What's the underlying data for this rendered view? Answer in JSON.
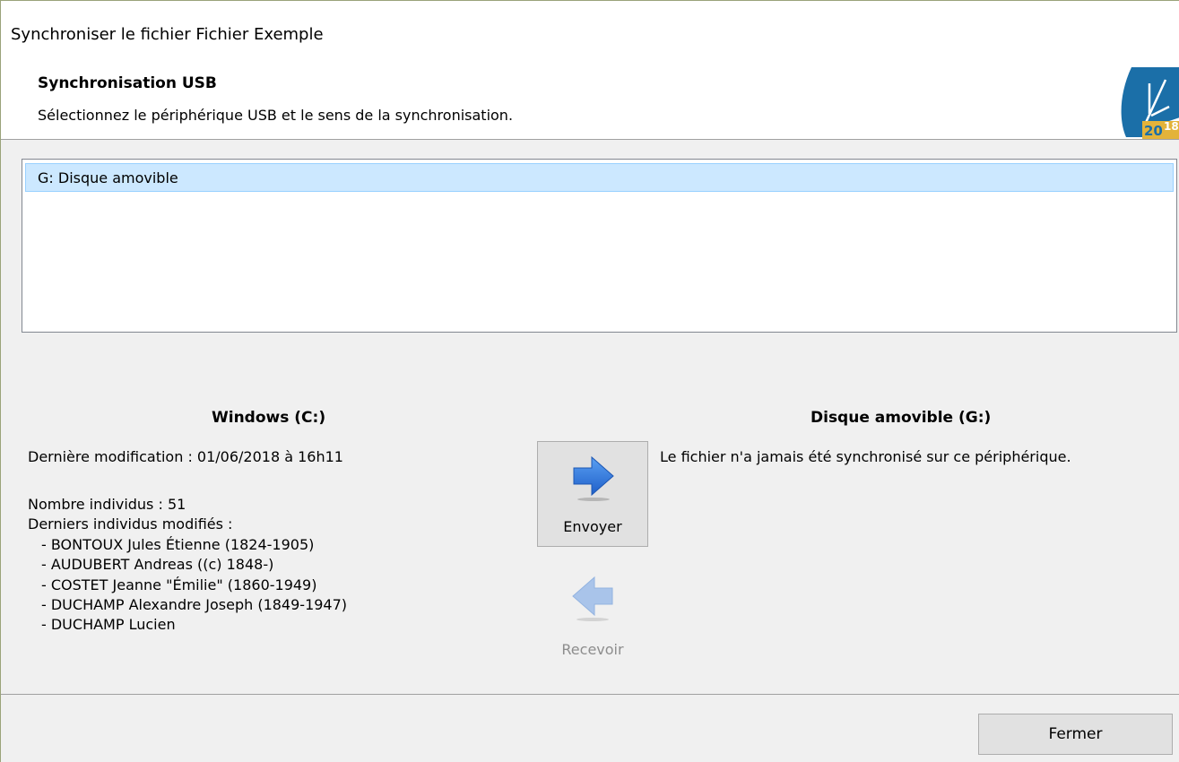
{
  "window": {
    "title": "Synchroniser le fichier Fichier Exemple"
  },
  "header": {
    "title": "Synchronisation USB",
    "subtitle": "Sélectionnez le périphérique USB et le sens de la synchronisation.",
    "logo_text": "2018"
  },
  "devices": {
    "items": [
      {
        "label": "G: Disque amovible",
        "selected": true
      }
    ]
  },
  "left_panel": {
    "title": "Windows (C:)",
    "last_modified": "Dernière modification : 01/06/2018 à 16h11",
    "count": "Nombre individus : 51",
    "recent_header": "Derniers individus modifiés :",
    "recent": [
      "- BONTOUX Jules Étienne (1824-1905)",
      "- AUDUBERT Andreas ((c) 1848-)",
      "- COSTET Jeanne \"Émilie\" (1860-1949)",
      "- DUCHAMP Alexandre Joseph (1849-1947)",
      "- DUCHAMP Lucien"
    ]
  },
  "right_panel": {
    "title": "Disque amovible (G:)",
    "status": "Le fichier n'a jamais été synchronisé sur ce périphérique."
  },
  "actions": {
    "send_label": "Envoyer",
    "send_icon": "arrow-right-icon",
    "receive_label": "Recevoir",
    "receive_icon": "arrow-left-icon",
    "receive_enabled": false
  },
  "footer": {
    "close_label": "Fermer"
  },
  "colors": {
    "selection": "#cce8ff",
    "selection_border": "#99d1ff",
    "arrow_active": "#2b6fd6",
    "arrow_disabled": "#a9c4ea",
    "logo_blue": "#1b6fa8",
    "logo_gold": "#e3b33a"
  }
}
